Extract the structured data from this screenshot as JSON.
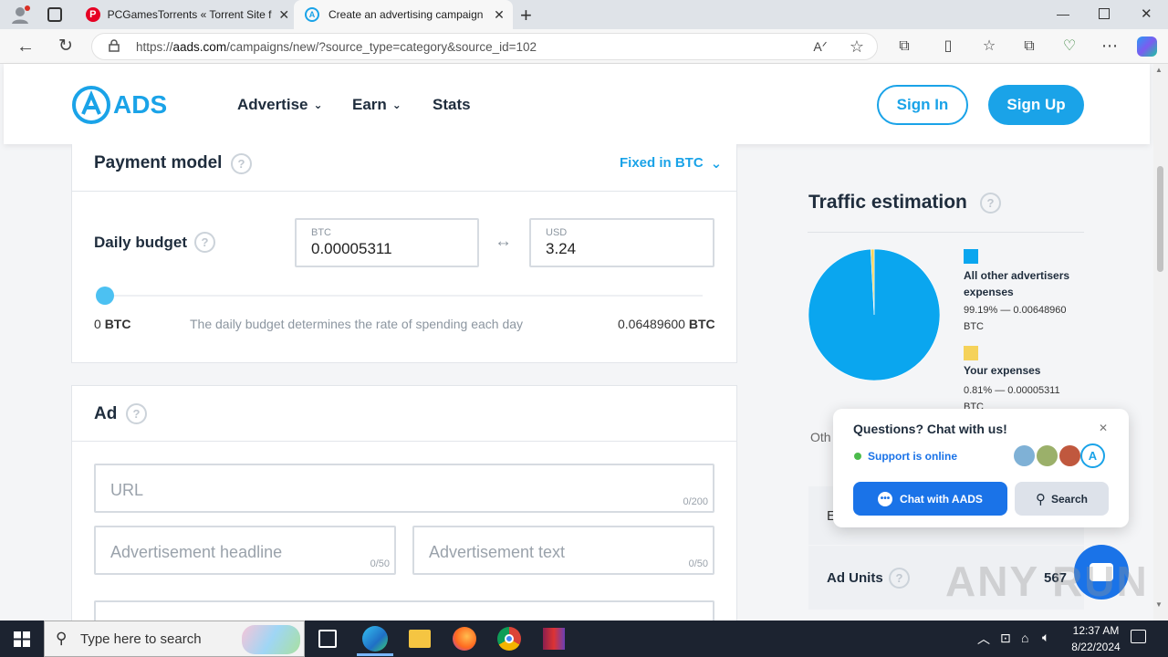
{
  "browser": {
    "tabs": [
      {
        "title": "PCGamesTorrents « Torrent Site f",
        "favicon": "pinterest-like-red-icon"
      },
      {
        "title": "Create an advertising campaign |",
        "favicon": "aads-icon",
        "active": true
      }
    ],
    "url_prefix": "https://",
    "url_domain": "aads.com",
    "url_path": "/campaigns/new/?source_type=category&source_id=102"
  },
  "site": {
    "logo_text": "ADS",
    "nav": [
      "Advertise",
      "Earn",
      "Stats"
    ],
    "sign_in": "Sign In",
    "sign_up": "Sign Up"
  },
  "payment": {
    "title": "Payment model",
    "model": "Fixed in BTC",
    "daily_budget_label": "Daily budget",
    "btc_label": "BTC",
    "btc_value": "0.00005311",
    "usd_label": "USD",
    "usd_value": "3.24",
    "min": "0",
    "min_unit": "BTC",
    "hint": "The daily budget determines the rate of spending each day",
    "max": "0.06489600",
    "max_unit": "BTC",
    "slider_level": 0.0008
  },
  "ad": {
    "title": "Ad",
    "url_placeholder": "URL",
    "url_count": "0/200",
    "headline_placeholder": "Advertisement headline",
    "headline_count": "0/50",
    "text_placeholder": "Advertisement text",
    "text_count": "0/50"
  },
  "traffic": {
    "title": "Traffic estimation",
    "legend": [
      {
        "name": "All other advertisers expenses",
        "pct": "99.19% — 0.00648960",
        "unit": "BTC",
        "color": "#0aa6ef"
      },
      {
        "name": "Your expenses",
        "pct": "0.81% — 0.00005311",
        "unit": "BTC",
        "color": "#f5d25a"
      }
    ],
    "other_partial": "Oth",
    "row_partial": "E",
    "ad_units_label": "Ad Units",
    "ad_units_value": "567"
  },
  "chat": {
    "title": "Questions? Chat with us!",
    "status": "Support is online",
    "chat_button": "Chat with AADS",
    "search_button": "Search"
  },
  "taskbar": {
    "search_placeholder": "Type here to search",
    "time": "12:37 AM",
    "date": "8/22/2024"
  },
  "watermark": "ANY RUN",
  "chart_data": {
    "type": "pie",
    "categories": [
      "All other advertisers expenses",
      "Your expenses"
    ],
    "values": [
      99.19,
      0.81
    ],
    "colors": [
      "#0aa6ef",
      "#f5d25a"
    ]
  }
}
